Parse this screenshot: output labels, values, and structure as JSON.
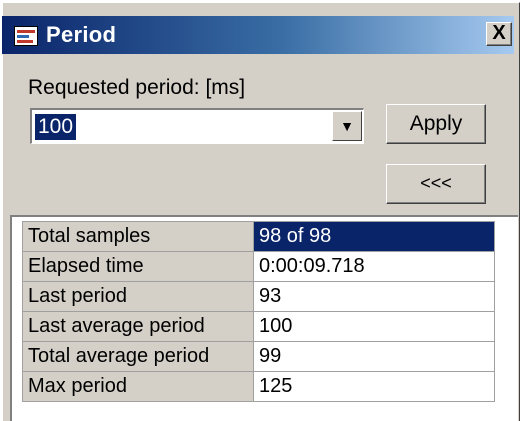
{
  "window": {
    "title": "Period",
    "close_label": "X"
  },
  "form": {
    "requested_label": "Requested period: [ms]",
    "period_value": "100",
    "apply_label": "Apply",
    "collapse_label": "<<<"
  },
  "stats": {
    "rows": [
      {
        "label": "Total samples",
        "value": "98 of 98"
      },
      {
        "label": "Elapsed time",
        "value": "0:00:09.718"
      },
      {
        "label": "Last period",
        "value": "93"
      },
      {
        "label": "Last average period",
        "value": "100"
      },
      {
        "label": "Total average period",
        "value": "99"
      },
      {
        "label": "Max period",
        "value": "125"
      }
    ],
    "selected_row": 0
  }
}
